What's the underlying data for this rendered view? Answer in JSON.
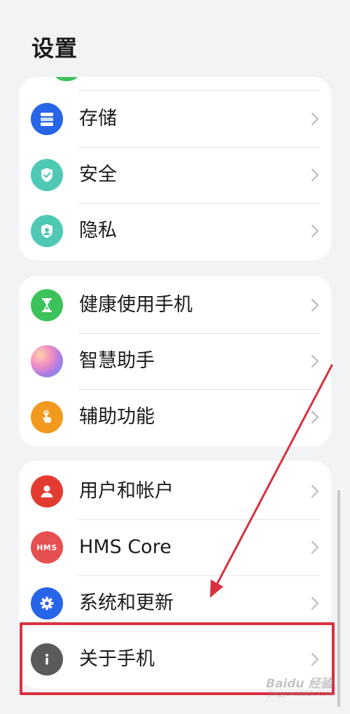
{
  "page_title": "设置",
  "groups": [
    {
      "items": [
        {
          "label": "存储",
          "icon": "storage-icon",
          "color": "#2765e8"
        },
        {
          "label": "安全",
          "icon": "security-shield-icon",
          "color": "#4fc8b4"
        },
        {
          "label": "隐私",
          "icon": "privacy-shield-icon",
          "color": "#4fc8b4"
        }
      ]
    },
    {
      "items": [
        {
          "label": "健康使用手机",
          "icon": "hourglass-icon",
          "color": "#3cc25a"
        },
        {
          "label": "智慧助手",
          "icon": "assistant-orb-icon",
          "color": "#c27ad8"
        },
        {
          "label": "辅助功能",
          "icon": "accessibility-hand-icon",
          "color": "#f29a1e"
        }
      ]
    },
    {
      "items": [
        {
          "label": "用户和帐户",
          "icon": "user-icon",
          "color": "#e23b32"
        },
        {
          "label": "HMS Core",
          "icon": "hms-core-icon",
          "color": "#e75050",
          "icon_text": "HMS"
        },
        {
          "label": "系统和更新",
          "icon": "system-update-gear-icon",
          "color": "#2765e8"
        },
        {
          "label": "关于手机",
          "icon": "info-icon",
          "color": "#5b5b5b"
        }
      ]
    }
  ],
  "annotation": {
    "highlight_color": "#d9303e",
    "arrow_color": "#d9303e"
  },
  "watermark": {
    "text": "Baidu 经验",
    "subtext": "jingyan.baidu.com"
  }
}
